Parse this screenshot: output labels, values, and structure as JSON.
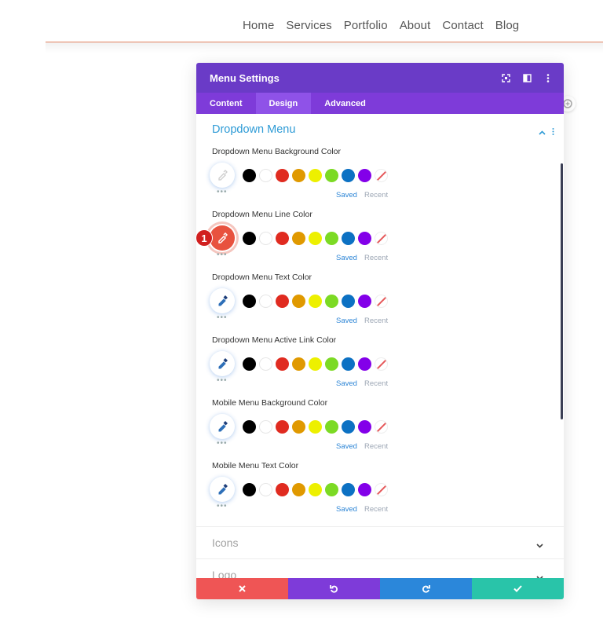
{
  "nav": {
    "links": [
      "Home",
      "Services",
      "Portfolio",
      "About",
      "Contact",
      "Blog"
    ]
  },
  "modal": {
    "title": "Menu Settings",
    "tabs": [
      "Content",
      "Design",
      "Advanced"
    ],
    "active_tab": "Design",
    "section": {
      "title": "Dropdown Menu",
      "fields": [
        {
          "label": "Dropdown Menu Background Color",
          "picker": "empty"
        },
        {
          "label": "Dropdown Menu Line Color",
          "picker": "active-red"
        },
        {
          "label": "Dropdown Menu Text Color",
          "picker": "eyedropper"
        },
        {
          "label": "Dropdown Menu Active Link Color",
          "picker": "eyedropper"
        },
        {
          "label": "Mobile Menu Background Color",
          "picker": "eyedropper"
        },
        {
          "label": "Mobile Menu Text Color",
          "picker": "eyedropper"
        }
      ],
      "swatch_colors": [
        "#000000",
        "#ffffff",
        "#e02b20",
        "#e09900",
        "#edf000",
        "#7cda24",
        "#0c71c3",
        "#8300e9"
      ],
      "saved_label": "Saved",
      "recent_label": "Recent"
    },
    "collapsed_sections": [
      "Icons",
      "Logo"
    ],
    "badge": "1"
  },
  "colors": {
    "header": "#6a3bc7",
    "tabs": "#7e3bd9",
    "active_tab": "#8f52e8",
    "accent_blue": "#2e9bd6",
    "cancel": "#ef5555",
    "undo": "#7e3bd9",
    "redo": "#2b87da",
    "save": "#29c4a9"
  }
}
